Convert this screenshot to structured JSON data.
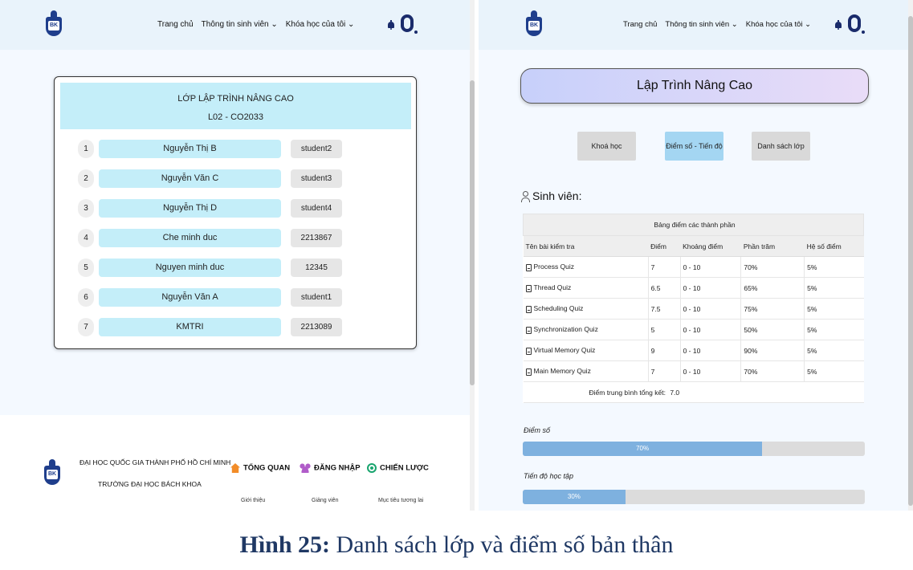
{
  "left": {
    "nav": {
      "home": "Trang chủ",
      "student_info": "Thông tin sinh viên ⌄",
      "my_courses": "Khóa học của tôi ⌄"
    },
    "logo_text": "BK",
    "class": {
      "title": "LỚP LẬP TRÌNH NÂNG CAO",
      "code": "L02 - CO2033",
      "students": [
        {
          "num": "1",
          "name": "Nguyễn Thị B",
          "id": "student2"
        },
        {
          "num": "2",
          "name": "Nguyễn Văn C",
          "id": "student3"
        },
        {
          "num": "3",
          "name": "Nguyễn Thị D",
          "id": "student4"
        },
        {
          "num": "4",
          "name": "Che minh duc",
          "id": "2213867"
        },
        {
          "num": "5",
          "name": "Nguyen minh duc",
          "id": "12345"
        },
        {
          "num": "6",
          "name": "Nguyễn Văn A",
          "id": "student1"
        },
        {
          "num": "7",
          "name": "KMTRI",
          "id": "2213089"
        }
      ]
    },
    "footer": {
      "university": "ĐẠI HỌC QUỐC GIA THÀNH PHỐ HỒ CHÍ MINH",
      "school": "TRƯỜNG ĐẠI HỌC BÁCH KHOA",
      "col1_title": "TỔNG QUAN",
      "col1_sub": "Giới thiệu",
      "col2_title": "ĐĂNG NHẬP",
      "col2_sub": "Giảng viên",
      "col3_title": "CHIẾN LƯỢC",
      "col3_sub": "Mục tiêu tương lai"
    }
  },
  "right": {
    "nav": {
      "home": "Trang chủ",
      "student_info": "Thông tin sinh viên ⌄",
      "my_courses": "Khóa học của tôi ⌄"
    },
    "course_title": "Lập Trình Nâng Cao",
    "tabs": [
      "Khoá học",
      "Điểm số - Tiến độ",
      "Danh sách lớp"
    ],
    "student_label": "Sinh viên:",
    "table": {
      "caption": "Bảng điểm các thành phần",
      "headers": [
        "Tên bài kiểm tra",
        "Điểm",
        "Khoảng điểm",
        "Phần trăm",
        "Hệ số điểm"
      ],
      "rows": [
        [
          "Process Quiz",
          "7",
          "0 - 10",
          "70%",
          "5%"
        ],
        [
          "Thread Quiz",
          "6.5",
          "0 - 10",
          "65%",
          "5%"
        ],
        [
          "Scheduling Quiz",
          "7.5",
          "0 - 10",
          "75%",
          "5%"
        ],
        [
          "Synchronization Quiz",
          "5",
          "0 - 10",
          "50%",
          "5%"
        ],
        [
          "Virtual Memory Quiz",
          "9",
          "0 - 10",
          "90%",
          "5%"
        ],
        [
          "Main Memory Quiz",
          "7",
          "0 - 10",
          "70%",
          "5%"
        ]
      ],
      "avg_label": "Điểm trung bình tổng kết:",
      "avg_value": "7.0"
    },
    "score_label": "Điểm số",
    "score_text": "70%",
    "score_fraction": 0.7,
    "progress_label": "Tiến độ học tập",
    "progress_text": "30%",
    "progress_fraction": 0.3
  },
  "caption": {
    "bold": "Hình 25:",
    "text": " Danh sách lớp và điểm số bản thân"
  }
}
